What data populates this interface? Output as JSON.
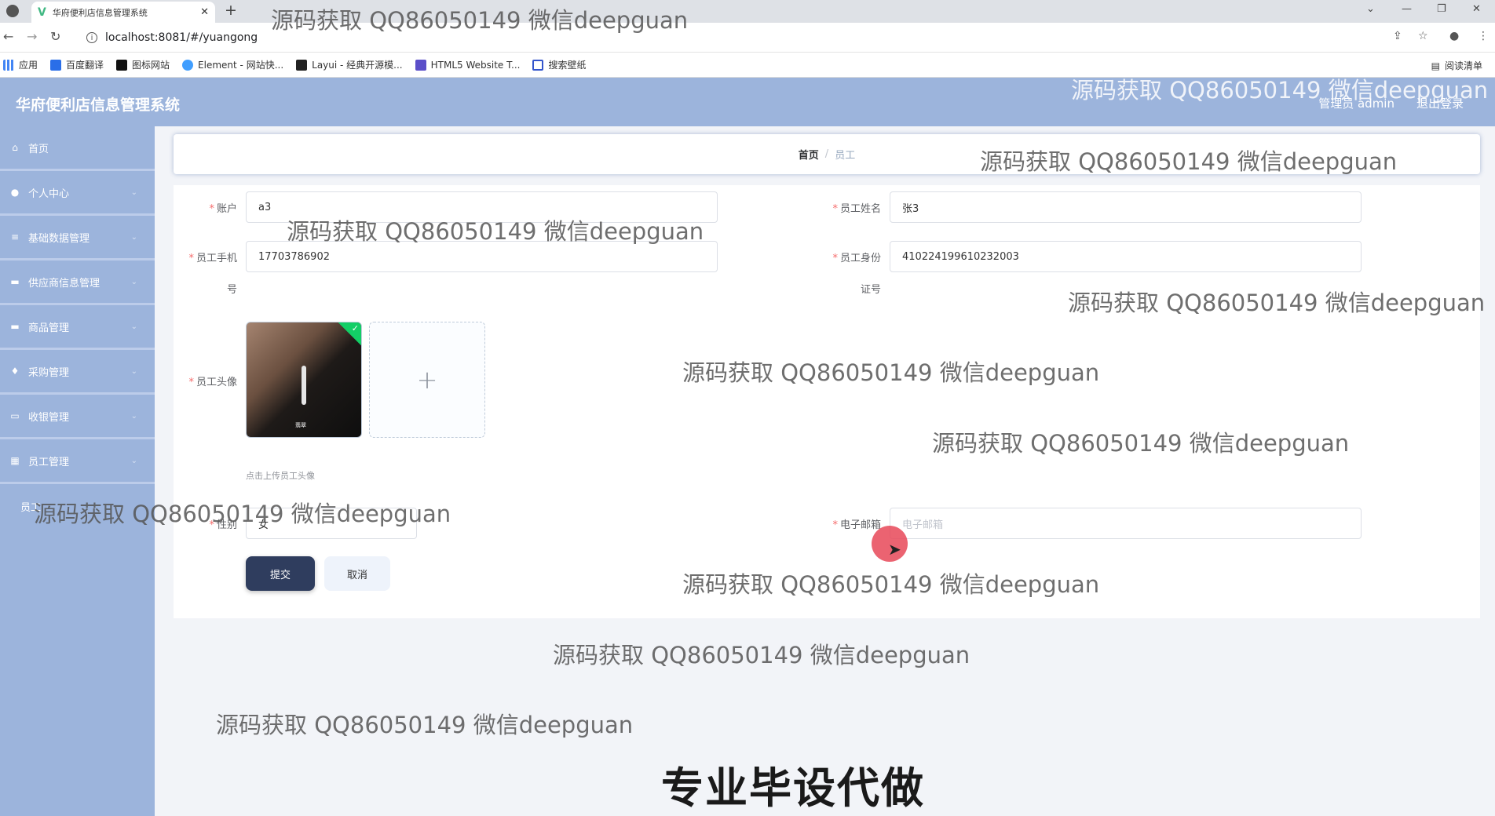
{
  "browser": {
    "tab_title": "华府便利店信息管理系统",
    "url": "localhost:8081/#/yuangong",
    "bookmarks": [
      "应用",
      "百度翻译",
      "图标网站",
      "Element - 网站快...",
      "Layui - 经典开源模...",
      "HTML5 Website T...",
      "搜索壁纸"
    ],
    "reading_list": "阅读清单"
  },
  "header": {
    "title": "华府便利店信息管理系统",
    "user": "管理员 admin",
    "logout": "退出登录"
  },
  "sidebar": {
    "items": [
      {
        "label": "首页",
        "icon": "home-icon"
      },
      {
        "label": "个人中心",
        "icon": "user-icon"
      },
      {
        "label": "基础数据管理",
        "icon": "list-icon"
      },
      {
        "label": "供应商信息管理",
        "icon": "folder-icon"
      },
      {
        "label": "商品管理",
        "icon": "box-icon"
      },
      {
        "label": "采购管理",
        "icon": "cart-icon"
      },
      {
        "label": "收银管理",
        "icon": "cash-icon"
      },
      {
        "label": "员工管理",
        "icon": "grid-icon"
      }
    ],
    "partial": "员工"
  },
  "breadcrumb": {
    "home": "首页",
    "sep": "/",
    "current": "员工"
  },
  "form": {
    "account": {
      "label": "账户",
      "value": "a3"
    },
    "name": {
      "label": "员工姓名",
      "value": "张3"
    },
    "phone": {
      "label_1": "员工手机",
      "label_2": "号",
      "value": "17703786902"
    },
    "id_card": {
      "label_1": "员工身份",
      "label_2": "证号",
      "value": "410224199610232003"
    },
    "avatar": {
      "label": "员工头像",
      "hint": "点击上传员工头像",
      "thumb_text": "翡翠"
    },
    "gender": {
      "label": "性别",
      "value": "女"
    },
    "email": {
      "label": "电子邮箱",
      "placeholder": "电子邮箱"
    },
    "submit": "提交",
    "cancel": "取消"
  },
  "watermark": "源码获取 QQ86050149 微信deepguan",
  "promo": "专业毕设代做"
}
